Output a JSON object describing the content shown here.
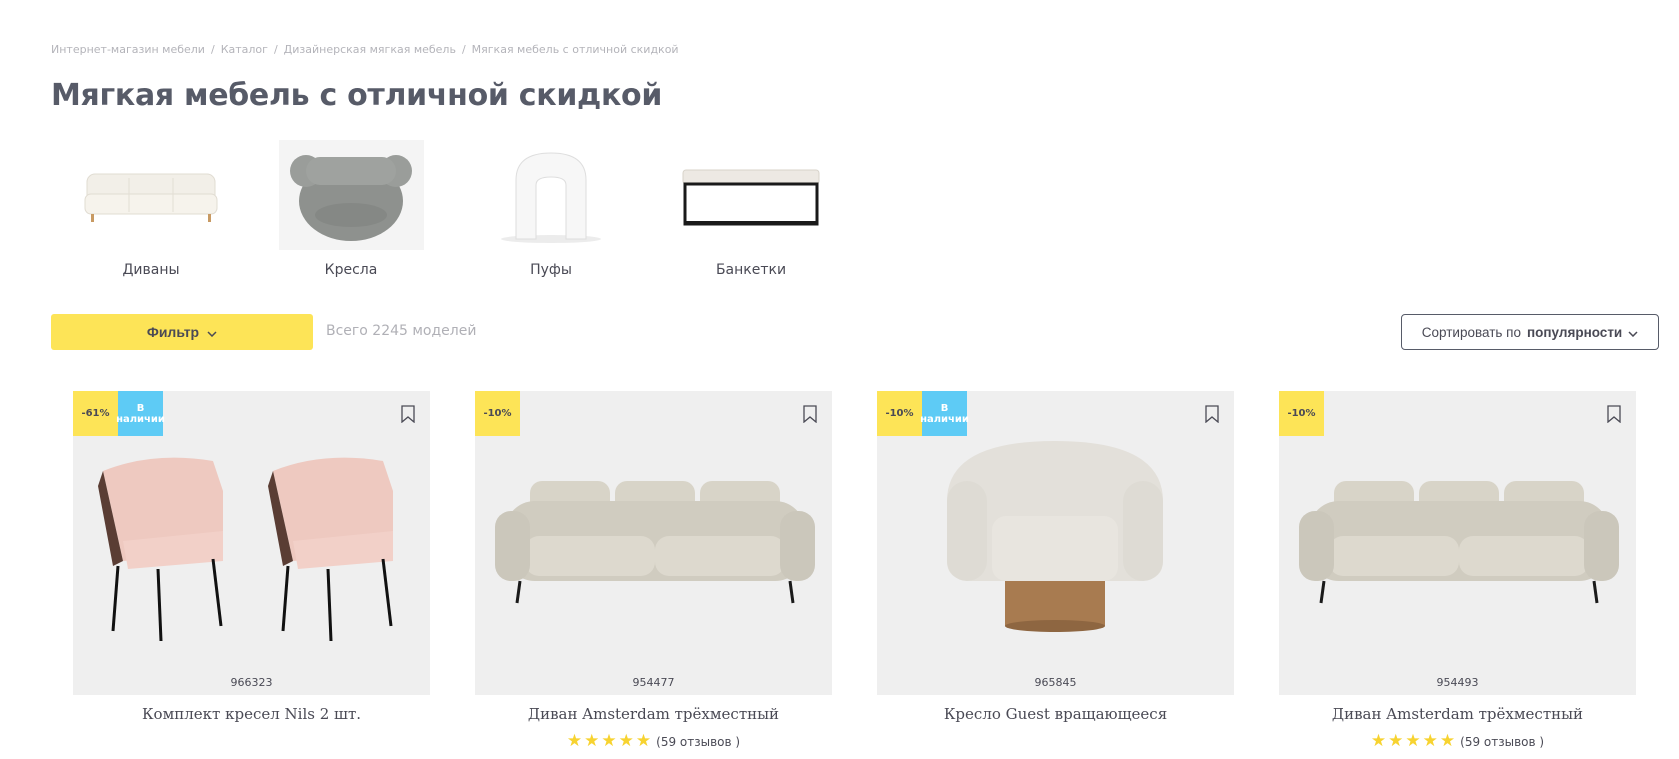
{
  "breadcrumb": [
    {
      "label": "Интернет-магазин мебели"
    },
    {
      "label": "Каталог"
    },
    {
      "label": "Дизайнерская мягкая мебель"
    },
    {
      "label": "Мягкая мебель с отличной скидкой"
    }
  ],
  "breadcrumb_separator": "/",
  "page_title": "Мягкая мебель с отличной скидкой",
  "categories": [
    {
      "label": "Диваны",
      "icon": "sofa-thumbnail"
    },
    {
      "label": "Кресла",
      "icon": "armchair-thumbnail"
    },
    {
      "label": "Пуфы",
      "icon": "pouf-thumbnail"
    },
    {
      "label": "Банкетки",
      "icon": "bench-thumbnail"
    }
  ],
  "toolbar": {
    "filter_label": "Фильтр",
    "total_label": "Всего 2245 моделей",
    "sort_prefix": "Сортировать по",
    "sort_value": "популярности"
  },
  "products": [
    {
      "discount": "-61%",
      "stock": "В наличии",
      "sku": "966323",
      "title": "Комплект кресел Nils 2 шт.",
      "rating": null,
      "reviews": ""
    },
    {
      "discount": "-10%",
      "stock": "",
      "sku": "954477",
      "title": "Диван Amsterdam трёхместный",
      "rating": 5,
      "reviews": "(59 отзывов )"
    },
    {
      "discount": "-10%",
      "stock": "В наличии",
      "sku": "965845",
      "title": "Кресло Guest вращающееся",
      "rating": null,
      "reviews": ""
    },
    {
      "discount": "-10%",
      "stock": "",
      "sku": "954493",
      "title": "Диван Amsterdam трёхместный",
      "rating": 5,
      "reviews": "(59 отзывов )"
    }
  ],
  "colors": {
    "accent_yellow": "#fde457",
    "stock_blue": "#5ecbf5",
    "star": "#f7d330",
    "title": "#575b68"
  }
}
